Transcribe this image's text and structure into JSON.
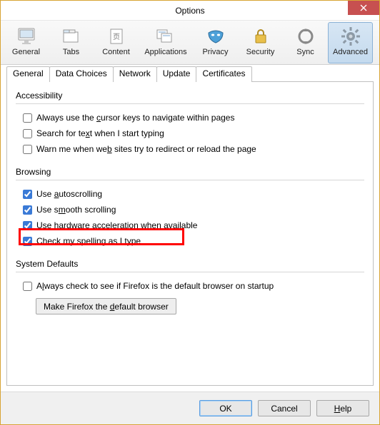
{
  "window": {
    "title": "Options"
  },
  "toolbar": {
    "items": [
      {
        "id": "general",
        "label": "General"
      },
      {
        "id": "tabs",
        "label": "Tabs"
      },
      {
        "id": "content",
        "label": "Content"
      },
      {
        "id": "applications",
        "label": "Applications"
      },
      {
        "id": "privacy",
        "label": "Privacy"
      },
      {
        "id": "security",
        "label": "Security"
      },
      {
        "id": "sync",
        "label": "Sync"
      },
      {
        "id": "advanced",
        "label": "Advanced"
      }
    ],
    "active": "advanced"
  },
  "subtabs": {
    "items": [
      "General",
      "Data Choices",
      "Network",
      "Update",
      "Certificates"
    ],
    "active": "General"
  },
  "groups": {
    "accessibility": {
      "title": "Accessibility",
      "options": [
        {
          "label_pre": "Always use the ",
          "hotkey": "c",
          "label_mid": "ursor keys to navigate within pages",
          "checked": false
        },
        {
          "label_pre": "Search for te",
          "hotkey": "x",
          "label_mid": "t when I start typing",
          "checked": false
        },
        {
          "label_pre": "Warn me when we",
          "hotkey": "b",
          "label_mid": " sites try to redirect or reload the page",
          "checked": false
        }
      ]
    },
    "browsing": {
      "title": "Browsing",
      "options": [
        {
          "label_pre": "Use ",
          "hotkey": "a",
          "label_mid": "utoscrolling",
          "checked": true
        },
        {
          "label_pre": "Use s",
          "hotkey": "m",
          "label_mid": "ooth scrolling",
          "checked": true
        },
        {
          "label_pre": "Use hard",
          "hotkey": "w",
          "label_mid": "are acceleration when available",
          "checked": true
        },
        {
          "label_pre": "Chec",
          "hotkey": "k",
          "label_mid": " my spelling as I type",
          "checked": true
        }
      ]
    },
    "defaults": {
      "title": "System Defaults",
      "option": {
        "label_pre": "A",
        "hotkey": "l",
        "label_mid": "ways check to see if Firefox is the default browser on startup",
        "checked": false
      },
      "button_pre": "Make Firefox the ",
      "button_hot": "d",
      "button_post": "efault browser"
    }
  },
  "footer": {
    "ok": "OK",
    "cancel": "Cancel",
    "help_hot": "H",
    "help_rest": "elp"
  }
}
